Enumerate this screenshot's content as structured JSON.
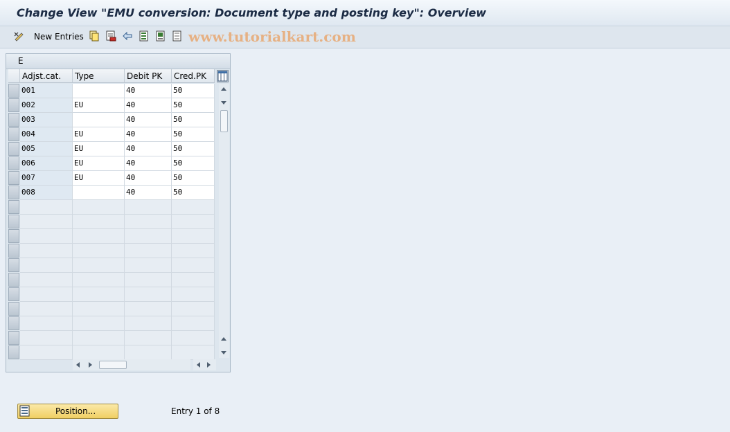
{
  "window": {
    "title": "Change View \"EMU conversion: Document type and posting key\": Overview"
  },
  "toolbar": {
    "new_entries_label": "New Entries",
    "watermark": "www.tutorialkart.com"
  },
  "table": {
    "title": "E",
    "columns": [
      "Adjst.cat.",
      "Type",
      "Debit PK",
      "Cred.PK"
    ],
    "rows": [
      [
        "001",
        "",
        "40",
        "50"
      ],
      [
        "002",
        "EU",
        "40",
        "50"
      ],
      [
        "003",
        "",
        "40",
        "50"
      ],
      [
        "004",
        "EU",
        "40",
        "50"
      ],
      [
        "005",
        "EU",
        "40",
        "50"
      ],
      [
        "006",
        "EU",
        "40",
        "50"
      ],
      [
        "007",
        "EU",
        "40",
        "50"
      ],
      [
        "008",
        "",
        "40",
        "50"
      ]
    ],
    "empty_rows": 11
  },
  "footer": {
    "position_button_label": "Position...",
    "entry_info": "Entry 1 of 8"
  }
}
